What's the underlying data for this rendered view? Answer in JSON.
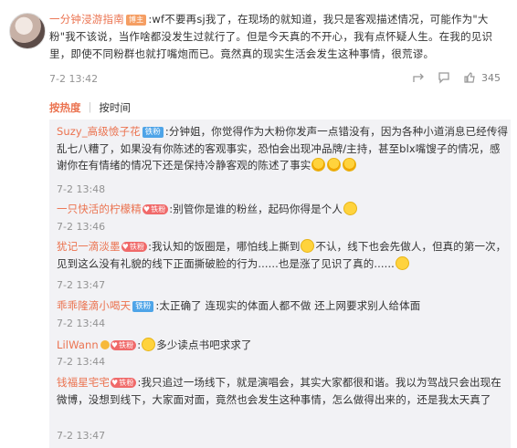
{
  "main_comment": {
    "username": "一分钟浸游指南",
    "badge": "博主",
    "text": ":wf不要再sj我了，在现场的就知道，我只是客观描述情况，可能作为\"大粉\"我不该说，当作啥都没发生过就行了。但是今天真的不开心，我有点怀疑人生。在我的见识里，即使不同粉群也就打嘴炮而已。竟然真的现实生活会发生这种事情，很荒谬。",
    "time": "7-2 13:42",
    "like_count": "345"
  },
  "sort": {
    "hot_label": "按热度",
    "time_label": "按时间"
  },
  "replies": [
    {
      "username": "Suzy_高级憸子花",
      "tag": "铁粉",
      "text": ":分钟姐，你觉得作为大粉你发声一点错没有，因为各种小道消息已经传得乱七八糟了，如果没有你陈述的客观事实，恐怕会出现冲品牌/主持，甚至blx嘴馊子的情况，感谢你在有情绪的情况下还是保持冷静客观的陈述了事实",
      "time": "7-2 13:48"
    },
    {
      "username": "一只快活的柠檬精",
      "fan_level": "铁粉",
      "text": ":别管你是谁的粉丝，起码你得是个人",
      "time": "7-2 13:46"
    },
    {
      "username": "犹记一滴淡墨",
      "fan_level": "铁粉",
      "text": ":我认知的饭圈是，哪怕线上撕到",
      "text2": "不认，线下也会先做人，但真的第一次，见到这么没有礼貌的线下正面撕破脸的行为......也是涨了见识了真的......",
      "time": "7-2 13:47"
    },
    {
      "username": "乖乖隆滴小喝天",
      "tag": "铁粉",
      "text": ":太正确了 连现实的体面人都不做 还上网要求别人给体面",
      "time": "7-2 13:44"
    },
    {
      "username": "LilWann",
      "fan_level": "铁粉",
      "text": "多少读点书吧求求了",
      "time": "7-2 13:44"
    },
    {
      "username": "钱福星宅宅",
      "fan_level": "铁粉",
      "text": ":我只追过一场线下，就是演唱会，其实大家都很和谐。我以为驾战只会出现在微博，没想到线下，大家面对面，竟然也会发生这种事情，怎么做得出来的，还是我太天真了",
      "time": "7-2 13:47"
    }
  ],
  "colors": {
    "accent": "#eb7350",
    "panel": "#f2f2f5",
    "tag_blue": "#4ea4e8"
  },
  "icons": [
    "share-icon",
    "comment-icon",
    "like-icon",
    "emoji-smile-icon",
    "emoji-hug-icon",
    "emoji-sob-icon",
    "heart-icon",
    "crown-icon"
  ]
}
